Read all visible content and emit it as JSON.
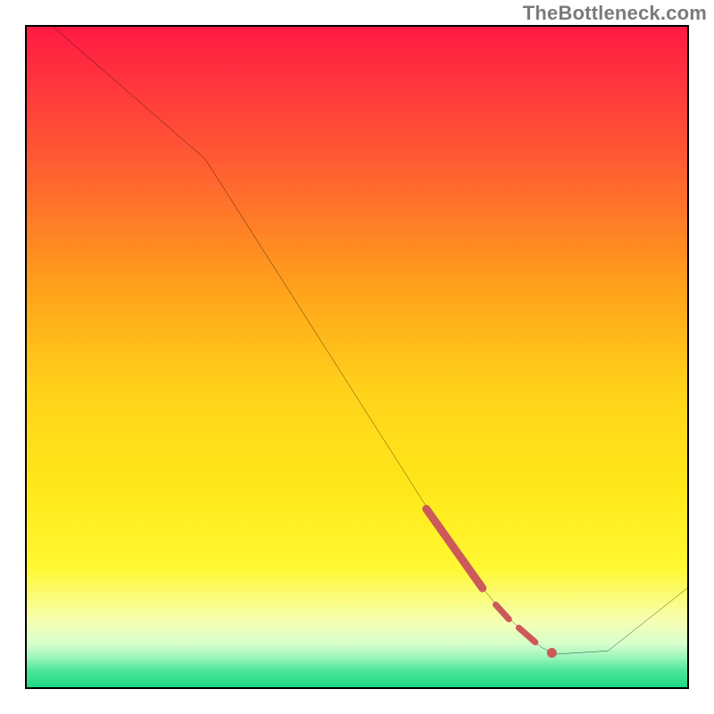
{
  "watermark": "TheBottleneck.com",
  "colors": {
    "border": "#000000",
    "line": "#000000",
    "marker": "#cc5a5a",
    "gradient_stops": [
      {
        "offset": 0.0,
        "color": "#ff1a44"
      },
      {
        "offset": 0.2,
        "color": "#ff5a33"
      },
      {
        "offset": 0.4,
        "color": "#ffa31a"
      },
      {
        "offset": 0.55,
        "color": "#ffd21a"
      },
      {
        "offset": 0.7,
        "color": "#ffe81a"
      },
      {
        "offset": 0.82,
        "color": "#fff833"
      },
      {
        "offset": 0.9,
        "color": "#f6ffb3"
      },
      {
        "offset": 0.935,
        "color": "#d6ffcc"
      },
      {
        "offset": 0.955,
        "color": "#99f5bb"
      },
      {
        "offset": 0.975,
        "color": "#4de69a"
      },
      {
        "offset": 1.0,
        "color": "#1ed985"
      }
    ]
  },
  "chart_data": {
    "type": "line",
    "title": "",
    "xlabel": "",
    "ylabel": "",
    "xlim": [
      0,
      100
    ],
    "ylim": [
      0,
      100
    ],
    "x": [
      4,
      27,
      62,
      66,
      69,
      71.5,
      74,
      76,
      78,
      80,
      88,
      100
    ],
    "values": [
      100,
      80,
      25,
      19,
      15,
      12,
      9.5,
      7.5,
      6,
      5,
      5.5,
      15
    ],
    "markers": [
      {
        "type": "segment",
        "x0": 60.5,
        "y0": 27,
        "x1": 69.0,
        "y1": 15,
        "width": 9
      },
      {
        "type": "segment",
        "x0": 71.0,
        "y0": 12.5,
        "x1": 73.0,
        "y1": 10.3,
        "width": 7
      },
      {
        "type": "segment",
        "x0": 74.5,
        "y0": 9.0,
        "x1": 77.0,
        "y1": 6.8,
        "width": 7
      },
      {
        "type": "point",
        "x": 79.5,
        "y": 5.2,
        "r": 5.5
      }
    ],
    "annotations": []
  }
}
